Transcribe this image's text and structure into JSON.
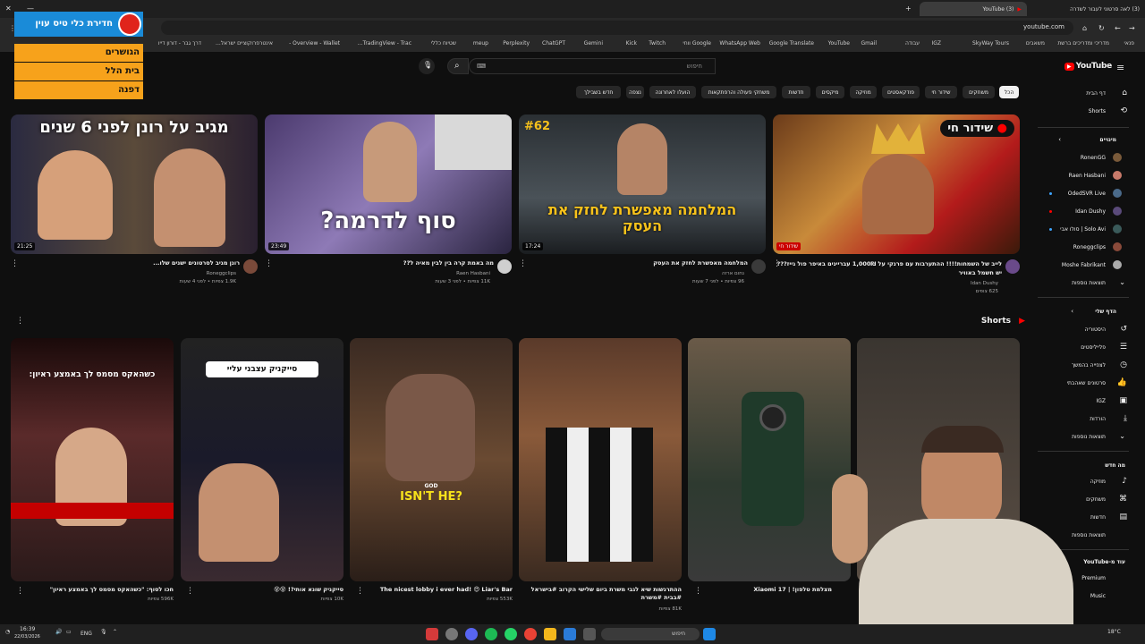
{
  "browser": {
    "tabs": [
      {
        "label": "(3) YouTube",
        "active": true
      },
      {
        "label": "(3) לאה סרטוני לעבור לשדרה"
      }
    ],
    "url": "youtube.com",
    "bookmarks": [
      "פנאי",
      "מדריכי ומדריכים ברשת",
      "משאבים",
      "SkyWay Tours",
      "IGZ",
      "עבודה",
      "Gmail",
      "YouTube",
      "Google Translate",
      "WhatsApp Web",
      "Google ווחי",
      "Twitch",
      "Kick",
      "Gemini",
      "ChatGPT",
      "Perplexity",
      "meup",
      "שטיוח כללי",
      "TradingView - Trac...",
      "Overview - Wallet -",
      "אינטרפרוקוציים ישראל...",
      "דרך גבר - דורון דייו"
    ]
  },
  "overlay": {
    "title": "חדירת כלי טיס עוין",
    "rows": [
      "הגושרים",
      "בית הלל",
      "דפנה"
    ]
  },
  "youtube": {
    "logo": "YouTube",
    "search_placeholder": "חיפוש",
    "chips": [
      "הכל",
      "משחקים",
      "שידור חי",
      "פודקאסטים",
      "מוזיקה",
      "מיקסים",
      "חדשות",
      "משחקי פעולה והרפתקאות",
      "הועלו לאחרונה",
      "נצפה",
      "חדש בשבילך"
    ],
    "videos": [
      {
        "title": "לייב של השמחות!!!! ההתערבות עם פרנקי על 1,000₪ עבריינים באיפר פול גייז??? יש חשמל באוויר",
        "channel": "Idan Dushy",
        "meta": "625 צופים",
        "duration": "שידור חי",
        "thumb_text": "שידור חי"
      },
      {
        "title": "המלחמה מאפשרת לחזק את העסק",
        "channel": "נחום ארזה",
        "meta": "96 צפיות • לפני 7 שעות",
        "duration": "17:24",
        "thumb_text": "המלחמה מאפשרת לחזק את העסק",
        "badge": "#62"
      },
      {
        "title": "מה באמת קרה בין לבין מאיה ל??",
        "channel": "Raen Hasbani",
        "meta": "11K צפיות • לפני 3 שעות",
        "duration": "23:49",
        "thumb_text": "סוף לדרמה?"
      },
      {
        "title": "רונן מגיב לסרטונים ישנים שלו...",
        "channel": "Roneggclips",
        "meta": "1.9K צפיות • לפני 4 שעות",
        "duration": "21:25",
        "thumb_text": "מגיב על רונן לפני 6 שנים"
      }
    ],
    "shorts_label": "Shorts",
    "shorts": [
      {
        "title": "",
        "views": ""
      },
      {
        "title": "מצלמת טלפון! | Xiaomi 17",
        "views": ""
      },
      {
        "title": "ההתרגשות שיא לגבי משרת ביום שלישי הקרוב #בישראל #בבית #משרת",
        "views": "81K צפיות"
      },
      {
        "title": "The nicest lobby i ever had! 😍 Liar's Bar",
        "views": "553K צפיות",
        "thumb_text": "ISN'T HE?",
        "thumb_small": "GOD"
      },
      {
        "title": "סייקניק שונא אותי?! 😵😵",
        "views": "10K צפיות",
        "thumb_text": "סייקניק עצבני עליי"
      },
      {
        "title": "חכו לסוף: \"כשהאקס מסמס לך באמצע ראיון\"",
        "views": "596K צפיות",
        "thumb_text": "כשהאקס מסמס לך באמצע ראיון:"
      }
    ],
    "sidebar": {
      "home": "דף הבית",
      "shorts": "Shorts",
      "subs_header": "מינויים",
      "subs": [
        "RonenGG",
        "Raen Hasbani",
        "OdedSVR Live",
        "Idan Dushy",
        "Solo Avi | סולו אבי",
        "Roneggclips",
        "Moshe Fabrikant"
      ],
      "subs_more": "תוצאות נוספות",
      "you_header": "הדף שלי",
      "you_items": [
        "היסטוריה",
        "פלייליסטים",
        "לצפייה בהמשך",
        "סרטונים שאהבתי",
        "IGZ",
        "הורדות"
      ],
      "you_more": "תוצאות נוספות",
      "explore_header": "מה חדש",
      "explore_items": [
        "מוזיקה",
        "משחקים",
        "חדשות"
      ],
      "explore_more": "תוצאות נוספות",
      "more_from": "עוד מ-YouTube",
      "more_items": [
        "Premium",
        "Music"
      ]
    }
  },
  "taskbar": {
    "time": "16:39",
    "date": "22/03/2026",
    "lang": "ENG",
    "search": "חיפוש",
    "weather": "18°C"
  },
  "colors": {
    "accent": "#ff0000",
    "overlay": "#f7a21b",
    "overlay_head": "#1a8bd8"
  }
}
